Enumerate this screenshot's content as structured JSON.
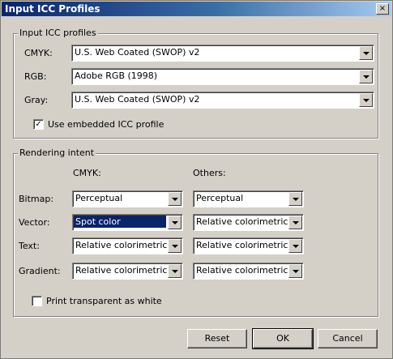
{
  "window": {
    "title": "Input ICC Profiles",
    "close_glyph": "×"
  },
  "input_group": {
    "legend": "Input ICC profiles",
    "rows": [
      {
        "label": "CMYK:",
        "value": "U.S. Web Coated (SWOP) v2"
      },
      {
        "label": "RGB:",
        "value": "Adobe RGB (1998)"
      },
      {
        "label": "Gray:",
        "value": "U.S. Web Coated (SWOP) v2"
      }
    ],
    "embedded": {
      "label": "Use embedded ICC profile",
      "checked": true,
      "mark": "✓"
    }
  },
  "rendering_group": {
    "legend": "Rendering intent",
    "col_cmyk": "CMYK:",
    "col_others": "Others:",
    "rows": [
      {
        "label": "Bitmap:",
        "cmyk": "Perceptual",
        "others": "Perceptual"
      },
      {
        "label": "Vector:",
        "cmyk": "Spot color",
        "others": "Relative colorimetric"
      },
      {
        "label": "Text:",
        "cmyk": "Relative colorimetric",
        "others": "Relative colorimetric"
      },
      {
        "label": "Gradient:",
        "cmyk": "Relative colorimetric",
        "others": "Relative colorimetric"
      }
    ],
    "transparent": {
      "label": "Print transparent as white",
      "checked": false
    }
  },
  "buttons": {
    "reset": "Reset",
    "ok": "OK",
    "cancel": "Cancel"
  },
  "colors": {
    "dialog_bg": "#d4d0c8",
    "title_start": "#0a246a",
    "title_end": "#a6caf0",
    "selection": "#0a246a"
  }
}
